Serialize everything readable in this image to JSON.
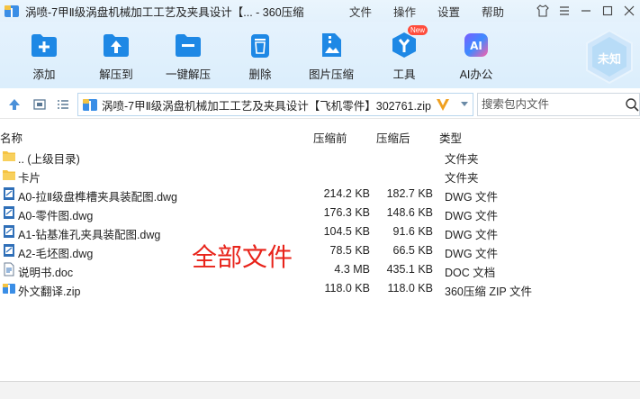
{
  "window": {
    "title": "涡喷-7甲Ⅱ级涡盘机械加工工艺及夹具设计【... - 360压缩"
  },
  "menus": [
    "文件",
    "操作",
    "设置",
    "帮助"
  ],
  "toolbar": {
    "items": [
      {
        "label": "添加",
        "icon": "add-icon"
      },
      {
        "label": "解压到",
        "icon": "extract-to-icon"
      },
      {
        "label": "一键解压",
        "icon": "one-click-extract-icon"
      },
      {
        "label": "删除",
        "icon": "delete-icon"
      },
      {
        "label": "图片压缩",
        "icon": "image-compress-icon"
      },
      {
        "label": "工具",
        "icon": "tools-icon",
        "badge": "New"
      },
      {
        "label": "AI办公",
        "icon": "ai-office-icon",
        "icon_text": "AI"
      }
    ],
    "account_label": "未知"
  },
  "address": {
    "path": "涡喷-7甲Ⅱ级涡盘机械加工工艺及夹具设计【飞机零件】302761.zip",
    "search_placeholder": "搜索包内文件"
  },
  "columns": {
    "name": "名称",
    "size": "压缩前",
    "compressed": "压缩后",
    "type": "类型"
  },
  "files": [
    {
      "name": ".. (上级目录)",
      "size": "",
      "compressed": "",
      "type": "文件夹",
      "icon": "folder-icon"
    },
    {
      "name": "卡片",
      "size": "",
      "compressed": "",
      "type": "文件夹",
      "icon": "folder-icon"
    },
    {
      "name": "A0-拉Ⅱ级盘榫槽夹具装配图.dwg",
      "size": "214.2 KB",
      "compressed": "182.7 KB",
      "type": "DWG 文件",
      "icon": "dwg-file-icon"
    },
    {
      "name": "A0-零件图.dwg",
      "size": "176.3 KB",
      "compressed": "148.6 KB",
      "type": "DWG 文件",
      "icon": "dwg-file-icon"
    },
    {
      "name": "A1-钻基准孔夹具装配图.dwg",
      "size": "104.5 KB",
      "compressed": "91.6 KB",
      "type": "DWG 文件",
      "icon": "dwg-file-icon"
    },
    {
      "name": "A2-毛坯图.dwg",
      "size": "78.5 KB",
      "compressed": "66.5 KB",
      "type": "DWG 文件",
      "icon": "dwg-file-icon"
    },
    {
      "name": "说明书.doc",
      "size": "4.3 MB",
      "compressed": "435.1 KB",
      "type": "DOC 文档",
      "icon": "doc-file-icon"
    },
    {
      "name": "外文翻译.zip",
      "size": "118.0 KB",
      "compressed": "118.0 KB",
      "type": "360压缩 ZIP 文件",
      "icon": "zip-file-icon"
    }
  ],
  "overlay_text": "全部文件",
  "colors": {
    "accent": "#1e88e5",
    "overlay": "#e8231a",
    "folder": "#f5c342"
  }
}
